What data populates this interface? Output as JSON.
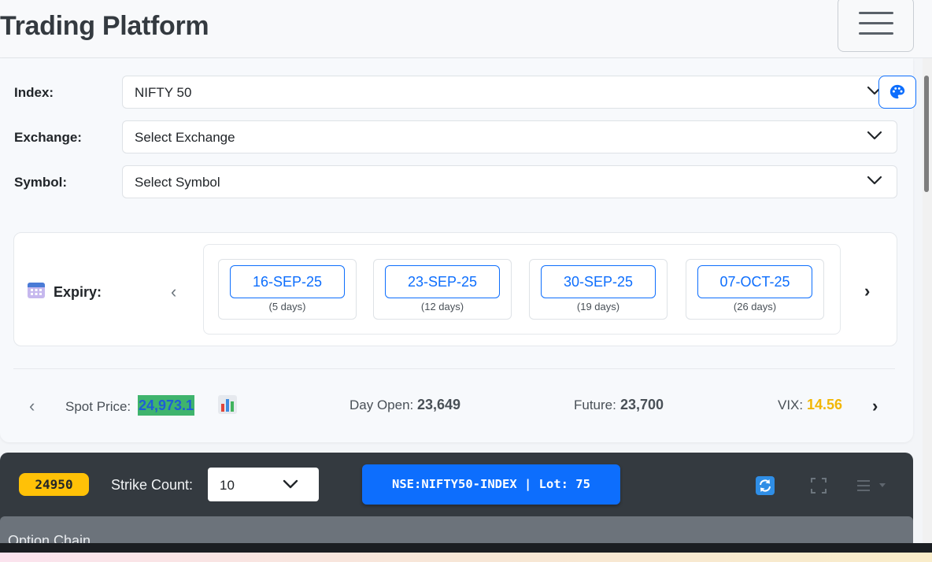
{
  "header": {
    "title": "Trading Platform",
    "menu_icon": "hamburger-menu-icon"
  },
  "form": {
    "index": {
      "label": "Index:",
      "value": "NIFTY 50"
    },
    "exchange": {
      "label": "Exchange:",
      "value": "Select Exchange"
    },
    "symbol": {
      "label": "Symbol:",
      "value": "Select Symbol"
    },
    "theme_icon": "palette-icon"
  },
  "expiry": {
    "label": "Expiry:",
    "icon": "calendar-icon",
    "items": [
      {
        "date": "16-SEP-25",
        "days": "(5 days)"
      },
      {
        "date": "23-SEP-25",
        "days": "(12 days)"
      },
      {
        "date": "30-SEP-25",
        "days": "(19 days)"
      },
      {
        "date": "07-OCT-25",
        "days": "(26 days)"
      }
    ],
    "prev_glyph": "‹",
    "next_glyph": "›"
  },
  "stats": {
    "spot_label": "Spot Price:",
    "spot_value": "24,973.1",
    "chart_icon": "bar-chart-icon",
    "day_open_label": "Day Open:",
    "day_open_value": "23,649",
    "future_label": "Future:",
    "future_value": "23,700",
    "vix_label": "VIX:",
    "vix_value": "14.56",
    "prev_glyph": "‹",
    "next_glyph": "›"
  },
  "toolbar": {
    "strike_badge": "24950",
    "strike_count_label": "Strike Count:",
    "strike_count_value": "10",
    "symbol_button": "NSE:NIFTY50-INDEX | Lot: 75",
    "refresh_icon": "refresh-icon",
    "fullscreen_icon": "fullscreen-icon",
    "menu_icon": "list-menu-icon"
  },
  "option_chain": {
    "title": "Option Chain"
  },
  "colors": {
    "primary": "#0d6efd",
    "toolbar_bg": "#343a40",
    "badge": "#ffc107",
    "spot_highlight": "#3fb46d",
    "vix": "#f2b705"
  }
}
